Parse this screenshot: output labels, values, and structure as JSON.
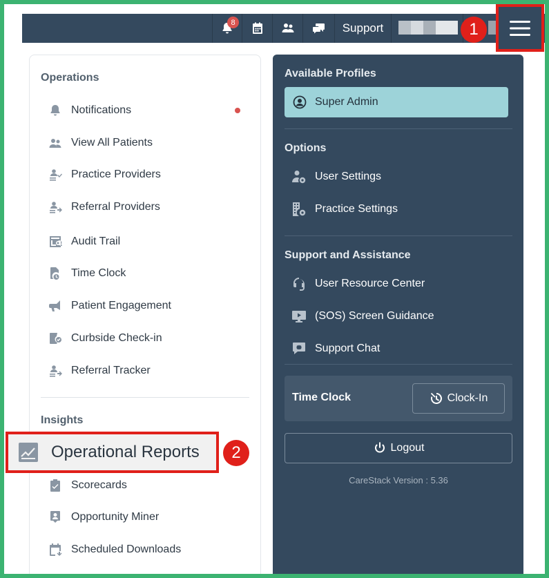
{
  "topbar": {
    "notification_count": "8",
    "support_label": "Support",
    "icons": [
      "bell-icon",
      "calendar-icon",
      "users-icon",
      "chat-icon",
      "hamburger-menu-icon"
    ]
  },
  "callouts": {
    "first": "1",
    "second": "2"
  },
  "left_menu": {
    "operations_title": "Operations",
    "operations_items": [
      {
        "label": "Notifications",
        "icon": "bell-icon",
        "has_dot": true
      },
      {
        "label": "View All Patients",
        "icon": "users-icon"
      },
      {
        "label": "Practice Providers",
        "icon": "providers-icon"
      },
      {
        "label": "Referral Providers",
        "icon": "referral-providers-icon"
      },
      {
        "label": "Audit Trail",
        "icon": "audit-icon"
      },
      {
        "label": "Time Clock",
        "icon": "time-clock-icon"
      },
      {
        "label": "Patient Engagement",
        "icon": "megaphone-icon"
      },
      {
        "label": "Curbside Check-in",
        "icon": "checkin-icon"
      },
      {
        "label": "Referral Tracker",
        "icon": "referral-tracker-icon"
      }
    ],
    "insights_title": "Insights",
    "insights_items": [
      {
        "label": "Operational Reports",
        "icon": "chart-icon"
      },
      {
        "label": "Scorecards",
        "icon": "clipboard-icon"
      },
      {
        "label": "Opportunity Miner",
        "icon": "miner-icon"
      },
      {
        "label": "Scheduled Downloads",
        "icon": "download-calendar-icon"
      }
    ]
  },
  "right_menu": {
    "profiles_title": "Available Profiles",
    "profile_name": "Super Admin",
    "options_title": "Options",
    "options": [
      {
        "label": "User Settings",
        "icon": "user-gear-icon"
      },
      {
        "label": "Practice Settings",
        "icon": "building-gear-icon"
      }
    ],
    "support_title": "Support and Assistance",
    "support_items": [
      {
        "label": "User Resource Center",
        "icon": "headset-icon"
      },
      {
        "label": "(SOS) Screen Guidance",
        "icon": "screen-play-icon"
      },
      {
        "label": "Support Chat",
        "icon": "support-chat-icon"
      }
    ],
    "time_clock_label": "Time Clock",
    "clock_in_label": "Clock-In",
    "logout_label": "Logout",
    "version": "CareStack Version : 5.36"
  },
  "colors": {
    "topbar": "#34495e",
    "profile": "#9dd3d9",
    "highlight": "#e0201a",
    "notification_dot": "#d9534f"
  }
}
